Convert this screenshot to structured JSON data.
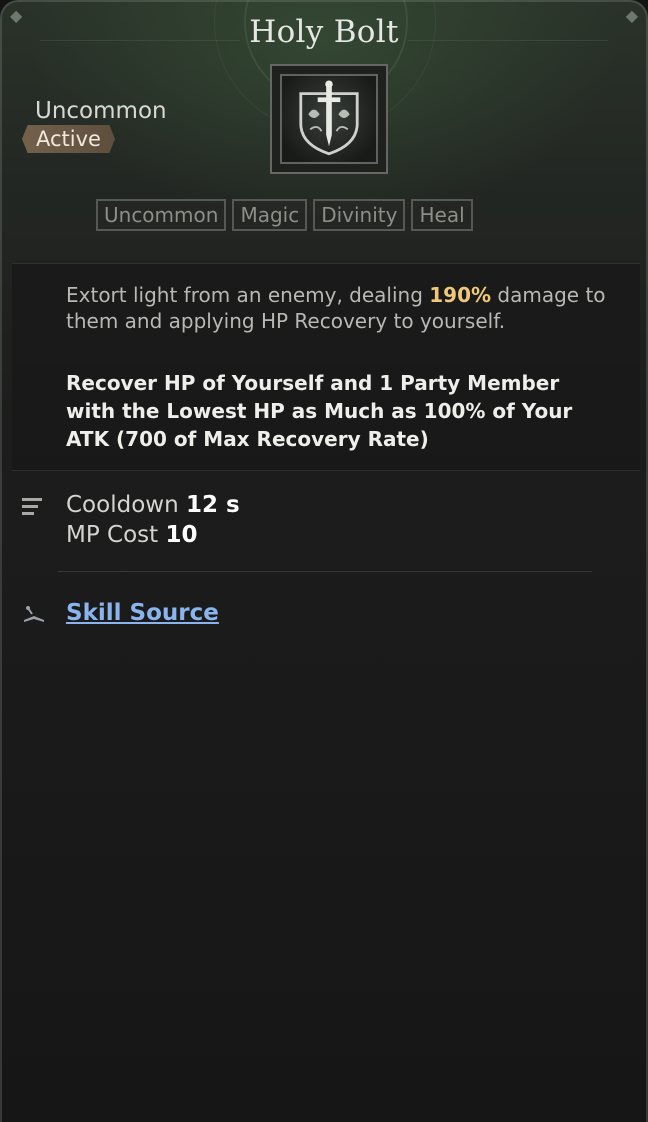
{
  "skill": {
    "title": "Holy Bolt",
    "rarity": "Uncommon",
    "type_badge": "Active",
    "icon": "sword-shield-icon"
  },
  "tags": [
    "Uncommon",
    "Magic",
    "Divinity",
    "Heal"
  ],
  "description": {
    "part1_before": "Extort light from an enemy, dealing ",
    "part1_highlight": "190%",
    "part1_after": " damage to them and applying HP Recovery to yourself.",
    "part2": "Recover HP of Yourself and 1 Party Member with the Lowest HP as Much as 100% of Your ATK (700 of Max Recovery Rate)"
  },
  "stats": {
    "cooldown_label": "Cooldown",
    "cooldown_value": "12 s",
    "mp_label": "MP Cost",
    "mp_value": "10"
  },
  "source": {
    "label": "Skill Source"
  },
  "colors": {
    "highlight": "#f0c878",
    "link": "#8ab4f0",
    "badge": "#786450"
  }
}
